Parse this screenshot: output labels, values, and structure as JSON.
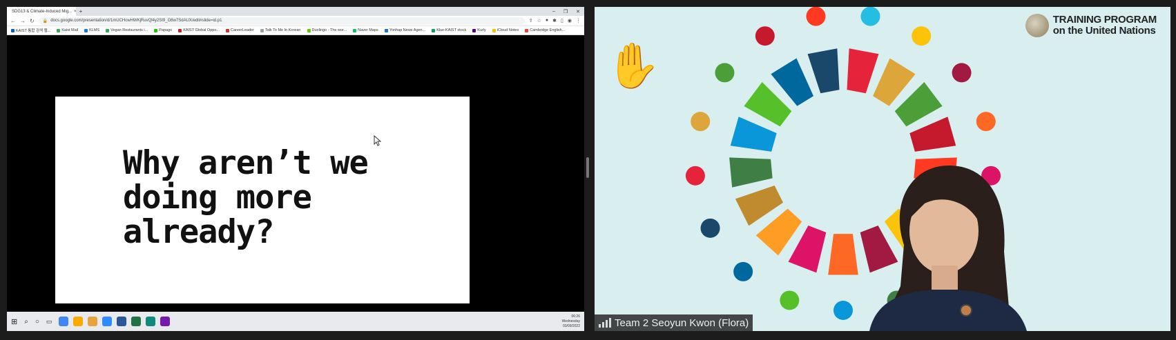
{
  "browser": {
    "tab_title": "SDG13 & Climate-Induced Mig...",
    "tab_close": "×",
    "new_tab": "+",
    "window_controls": [
      "–",
      "❐",
      "✕"
    ],
    "url": "docs.google.com/presentation/d/1mUCHcwHWKjRuvQl4y2SI9_O8w7SdAUX/edit#slide=id.p1",
    "bookmarks": [
      {
        "label": "KAIST 통합 검색 웹...",
        "color": "#0b57d0"
      },
      {
        "label": "Kaist Mail",
        "color": "#3aa757"
      },
      {
        "label": "KLMS",
        "color": "#1a73e8"
      },
      {
        "label": "Vegan Restaurants i...",
        "color": "#34a853"
      },
      {
        "label": "Papago",
        "color": "#1ec800"
      },
      {
        "label": "KAIST Global Oppo...",
        "color": "#c5221f"
      },
      {
        "label": "CareerLeader",
        "color": "#d93025"
      },
      {
        "label": "Talk To Me In Korean",
        "color": "#9aa0a6"
      },
      {
        "label": "Duolingo - The wor...",
        "color": "#58cc02"
      },
      {
        "label": "Naver Maps",
        "color": "#03c75a"
      },
      {
        "label": "Yonhap News Agen...",
        "color": "#1a73e8"
      },
      {
        "label": "Klue-KAIST stock",
        "color": "#0f9d58"
      },
      {
        "label": "Kurly",
        "color": "#5f0080"
      },
      {
        "label": "iCloud Notes",
        "color": "#fbbc04"
      },
      {
        "label": "Cambridge English...",
        "color": "#ea4335"
      }
    ]
  },
  "slide": {
    "lines": [
      "Why aren’t we",
      "doing more",
      "already?"
    ]
  },
  "taskbar": {
    "time": "06:26",
    "day": "Wednesday",
    "date": "03/09/2022",
    "apps": [
      "#4285f4",
      "#f9ab00",
      "#e8a33b",
      "#2d8cff",
      "#2b579a",
      "#217346",
      "#0f8a7e",
      "#7719aa"
    ]
  },
  "video": {
    "logo_line1": "TRAINING PROGRAM",
    "logo_line2": "on the United Nations",
    "participant_name": "Team 2 Seoyun Kwon (Flora)",
    "raised_hand": "✋"
  },
  "sdg_colors": [
    "#e5243b",
    "#dda63a",
    "#4c9f38",
    "#c5192d",
    "#ff3a21",
    "#26bde2",
    "#fcc30b",
    "#a21942",
    "#fd6925",
    "#dd1367",
    "#fd9d24",
    "#bf8b2e",
    "#3f7e44",
    "#0a97d9",
    "#56c02b",
    "#00689d",
    "#19486a"
  ],
  "colors": {
    "video_bg": "#d9eeef",
    "share_bg": "#000000"
  }
}
